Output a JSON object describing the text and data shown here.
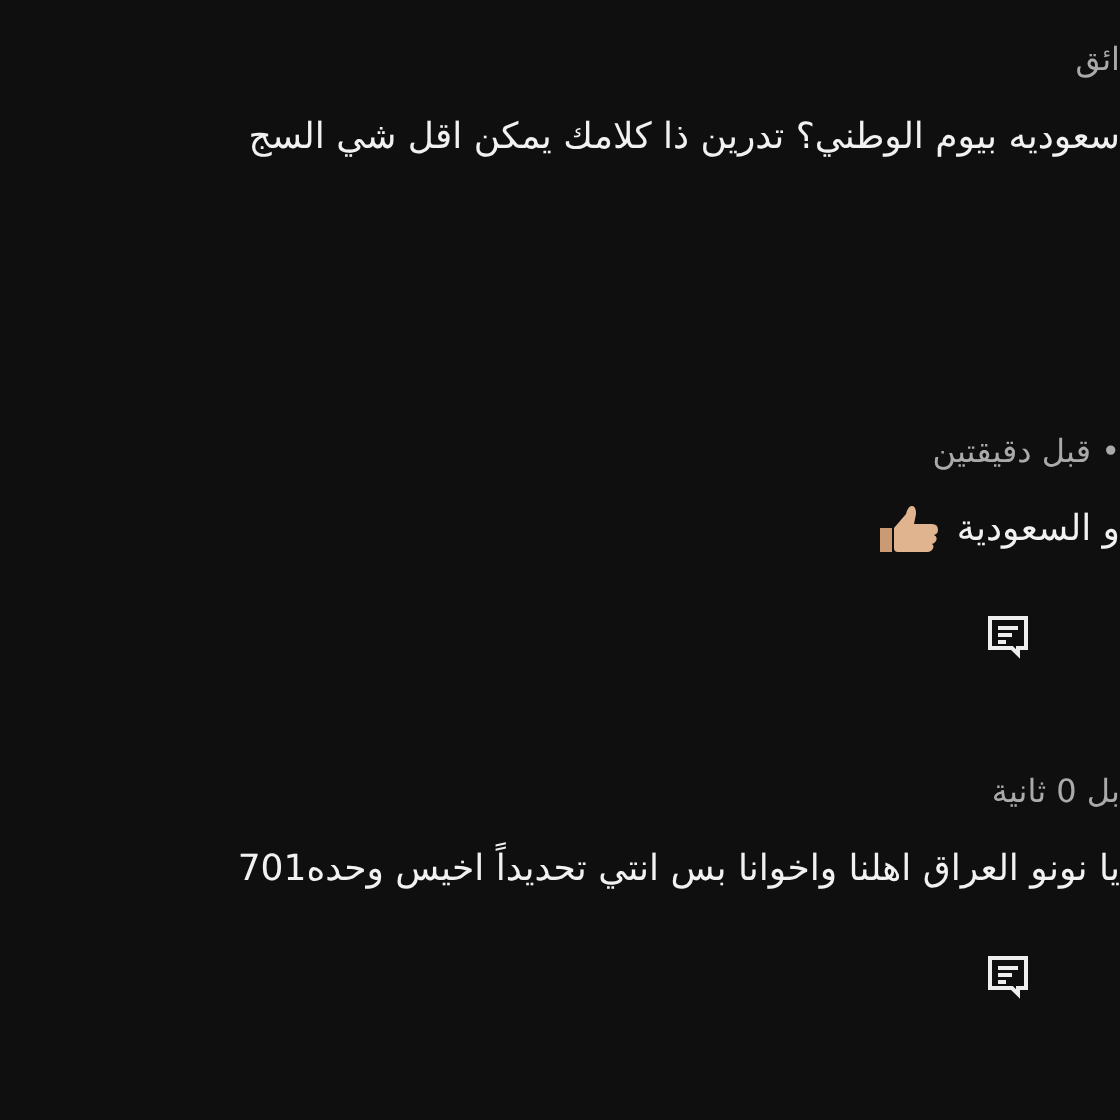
{
  "comments": [
    {
      "meta": "ائق",
      "body": "سعوديه بيوم الوطني؟ تدرين ذا كلامك يمكن اقل شي السج",
      "thumbs_up": false,
      "reply": false
    },
    {
      "meta": "• قبل دقيقتين",
      "body": "و السعودية",
      "thumbs_up": true,
      "reply": true
    },
    {
      "meta": "بل 0 ثانية",
      "body": "يا نونو العراق اهلنا واخوانا بس انتي تحديداً اخيس وحده701",
      "thumbs_up": false,
      "reply": true
    }
  ]
}
